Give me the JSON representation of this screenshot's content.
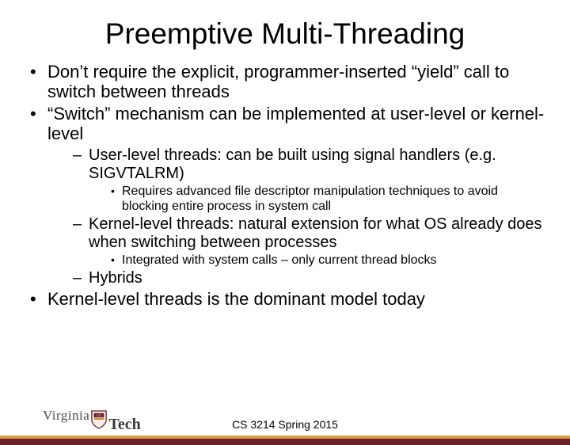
{
  "title": "Preemptive Multi-Threading",
  "bullets": {
    "b1": "Don’t require the explicit, programmer-inserted “yield” call to switch between threads",
    "b2": "“Switch” mechanism can be implemented at user-level or kernel-level",
    "b2_1": "User-level threads: can be built using signal handlers (e.g. SIGVTALRM)",
    "b2_1_1": "Requires advanced file descriptor manipulation techniques to avoid blocking entire process in system call",
    "b2_2": "Kernel-level threads: natural extension for what OS already does when switching between processes",
    "b2_2_1": "Integrated with system calls – only current thread blocks",
    "b2_3": "Hybrids",
    "b3": "Kernel-level threads is the dominant model today"
  },
  "footer": {
    "course": "CS 3214 Spring 2015",
    "logo_word1": "Virginia",
    "logo_word2": "Tech"
  }
}
